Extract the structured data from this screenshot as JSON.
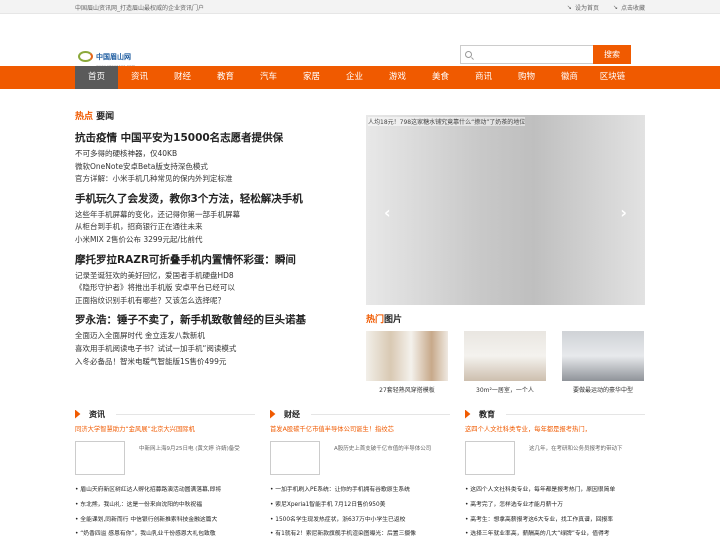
{
  "topbar": {
    "left": "中国眉山资讯网_打造眉山最权威的企业资讯门户",
    "home": "设为首页",
    "fav": "点击收藏"
  },
  "logo": {
    "name": "中国眉山网",
    "url": "www.sgnsoose.com"
  },
  "search": {
    "placeholder": "",
    "button": "搜索"
  },
  "nav": [
    "首页",
    "资讯",
    "财经",
    "教育",
    "汽车",
    "家居",
    "企业",
    "游戏",
    "美食",
    "商讯",
    "购物",
    "徽商",
    "区块链"
  ],
  "hot": {
    "label_a": "热点",
    "label_b": "要闻",
    "groups": [
      {
        "title": "抗击疫情 中国平安为15000名志愿者提供保",
        "items": [
          "不可多得的硬核神器，仅40KB",
          "微软OneNote安卓Beta版支持深色模式",
          "官方详解：小米手机几种常见的保内外判定标准"
        ]
      },
      {
        "title": "手机玩久了会发烫，教你3个方法，轻松解决手机",
        "items": [
          "这些年手机屏幕的变化，还记得你第一部手机屏幕",
          "从柜台到手机，招商银行正在通往未来",
          "小米MIX 2售价公布 3299元起/比前代"
        ]
      },
      {
        "title": "摩托罗拉RAZR可折叠手机内置情怀彩蛋：瞬间",
        "items": [
          "记录圣诞狂欢的美好回忆，爱国者手机硬盘HD8",
          "《隐形守护者》将推出手机版 安卓平台已经可以",
          "正面指纹识别手机有哪些？又该怎么选择呢？"
        ]
      },
      {
        "title": "罗永浩：锤子不卖了，新手机致敬曾经的巨头诺基",
        "items": [
          "全面迈入全面屏时代 金立连发八款新机",
          "喜欢用手机阅读电子书？试试一加手机“阅读模式",
          "入冬必备品！智米电暖气智能版1S售价499元"
        ]
      }
    ]
  },
  "slider": {
    "caption": "人均18元！798这家糖水铺究竟靠什么“撩动”了奶茶的地位",
    "prev": "‹",
    "next": "›"
  },
  "pictures": {
    "label_a": "热门",
    "label_b": "图片",
    "items": [
      {
        "caption": "27套轻熟风穿搭模板"
      },
      {
        "caption": "30m²一居室，一个人"
      },
      {
        "caption": "要做最运动的豪华中型"
      }
    ]
  },
  "columns": [
    {
      "title": "资讯",
      "headline": "同济大学智慧助力“金风展”北京大兴国际机",
      "desc": "中新网上海9月25日电 (黄文婷 许婧)备受",
      "items": [
        "眉山天府新区树红达人孵化招募路演活动圆满落幕,即将",
        "东北熊，我山礼：这是一份来自沈阳的中秋祝福",
        "全能课划,同新而行 中信银行创新推索科技金融这篇大",
        "“奶香四溢 感恩有你”，我山乳业千份感恩大礼包致敬"
      ]
    },
    {
      "title": "财经",
      "headline": "首发A股碳千亿市值半导体公司诞生！指纹芯",
      "desc": "A股历史上首支破千亿市值的半导体公司",
      "items": [
        "一加手机刷入PE系统：让你的手机拥有谷歌原生系统",
        "索尼Xperia1智能手机 7月12日售价950美",
        "1500名学生现发热症状，浙637万中小学生已返校",
        "有1就有2！索尼新款旗舰手机渲染图曝光：后置三摄像"
      ]
    },
    {
      "title": "教育",
      "headline": "这四个人文社科类专业，每年都是报考热门，",
      "desc": "这几年，在考研和公务员报考的带动下",
      "items": [
        "这四个人文社科类专业，每年都是报考热门，原因很简单",
        "高考完了，怎样选专业才能月薪十万",
        "高考生：想拿高薪报考这6大专业，找工作真谱，回报率",
        "选择三年就业率高，薪酬高的几大“绿牌”专业，值得考"
      ]
    }
  ]
}
